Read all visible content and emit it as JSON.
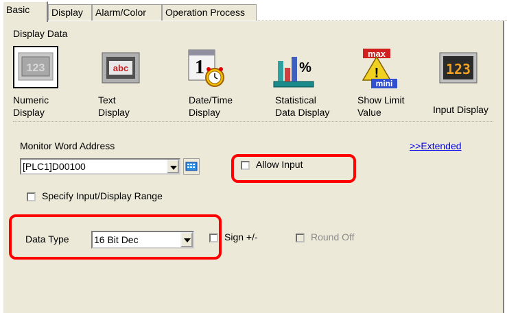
{
  "tabs": [
    {
      "label": "Basic"
    },
    {
      "label": "Display"
    },
    {
      "label": "Alarm/Color"
    },
    {
      "label": "Operation Process"
    }
  ],
  "display_data": {
    "label": "Display Data",
    "items": [
      {
        "line1": "Numeric",
        "line2": "Display",
        "icon": "numeric-display-icon"
      },
      {
        "line1": "Text",
        "line2": "Display",
        "icon": "text-display-icon"
      },
      {
        "line1": "Date/Time",
        "line2": "Display",
        "icon": "datetime-display-icon"
      },
      {
        "line1": "Statistical",
        "line2": "Data Display",
        "icon": "statistical-display-icon"
      },
      {
        "line1": "Show Limit",
        "line2": "Value",
        "icon": "show-limit-icon"
      },
      {
        "line1": "Input Display",
        "line2": "",
        "icon": "input-display-icon"
      }
    ],
    "icon_texts": {
      "numeric": "123",
      "text": "abc",
      "date": "1",
      "percent": "%",
      "max": "max",
      "mini": "mini",
      "input": "123"
    }
  },
  "monitor": {
    "label": "Monitor Word Address",
    "value": "[PLC1]D00100",
    "extended_link": ">>Extended",
    "allow_input": "Allow Input",
    "specify_range": "Specify Input/Display Range"
  },
  "data_type": {
    "label": "Data Type",
    "value": "16 Bit Dec",
    "sign": "Sign +/-",
    "round_off": "Round Off"
  },
  "colors": {
    "highlight": "#ff0000",
    "panel": "#ece9d8",
    "link": "#0000ee"
  }
}
